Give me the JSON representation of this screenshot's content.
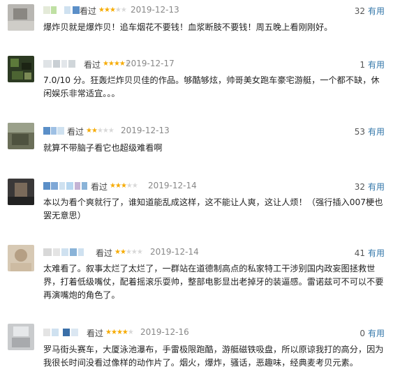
{
  "reviews": [
    {
      "seen": "看过",
      "stars": 3,
      "date": "2019-12-13",
      "useful_count": "32",
      "useful_label": "有用",
      "content": "爆炸贝就是爆炸贝！追车烟花不要钱！血浆断肢不要钱！周五晚上看刚刚好。"
    },
    {
      "seen": "看过",
      "stars": 4,
      "date": "2019-12-17",
      "useful_count": "1",
      "useful_label": "有用",
      "content": "7.0/10 分。狂轰烂炸贝贝佳的作品。够酷够炫，帅哥美女跑车豪宅游艇，一个都不缺，休闲娱乐非常适宜。。。"
    },
    {
      "seen": "看过",
      "stars": 2,
      "date": "2019-12-13",
      "useful_count": "53",
      "useful_label": "有用",
      "content": "就算不带脑子看它也超级难看啊"
    },
    {
      "seen": "看过",
      "stars": 3,
      "date": "2019-12-14",
      "useful_count": "32",
      "useful_label": "有用",
      "content": "本以为看个爽就行了，谁知道能乱成这样，这不能让人爽，这让人烦！（强行插入007梗也罢无意思）"
    },
    {
      "seen": "看过",
      "stars": 2,
      "date": "2019-12-14",
      "useful_count": "41",
      "useful_label": "有用",
      "content": "太难看了。叙事太烂了太烂了，一群站在道德制高点的私家特工干涉别国内政妄图拯救世界，打着低级嘴仗，配着摇滚乐耍帅，整部电影显出老掉牙的装逼感。雷诺兹可不可以不要再演嘴炮的角色了。"
    },
    {
      "seen": "看过",
      "stars": 4,
      "date": "2019-12-16",
      "useful_count": "0",
      "useful_label": "有用",
      "content": "罗马街头赛车，大厦泳池瀑布，手雷极限跑酷，游艇磁铁吸盘，所以原谅我打的高分，因为我很长时间没看过像样的动作片了。烟火，爆炸，骚话，恶趣味，经典麦考贝元素。"
    }
  ]
}
